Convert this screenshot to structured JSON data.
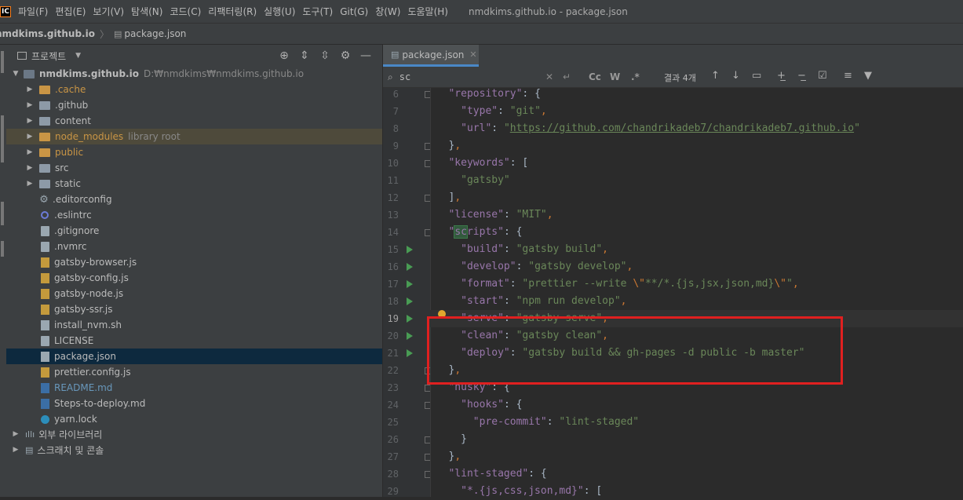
{
  "menu": {
    "logo": "IC",
    "items": [
      "파일(F)",
      "편집(E)",
      "보기(V)",
      "탐색(N)",
      "코드(C)",
      "리팩터링(R)",
      "실행(U)",
      "도구(T)",
      "Git(G)",
      "창(W)",
      "도움말(H)"
    ],
    "window_title": "nmdkims.github.io - package.json"
  },
  "breadcrumb": {
    "root": "nmdkims.github.io",
    "file": "package.json"
  },
  "project": {
    "title": "프로젝트",
    "root": {
      "name": "nmdkims.github.io",
      "path": "D:₩nmdkims₩nmdkims.github.io"
    },
    "items": [
      {
        "label": ".cache",
        "hint": ""
      },
      {
        "label": ".github",
        "hint": ""
      },
      {
        "label": "content",
        "hint": ""
      },
      {
        "label": "node_modules",
        "hint": "library root"
      },
      {
        "label": "public",
        "hint": ""
      },
      {
        "label": "src",
        "hint": ""
      },
      {
        "label": "static",
        "hint": ""
      },
      {
        "label": ".editorconfig",
        "hint": ""
      },
      {
        "label": ".eslintrc",
        "hint": ""
      },
      {
        "label": ".gitignore",
        "hint": ""
      },
      {
        "label": ".nvmrc",
        "hint": ""
      },
      {
        "label": "gatsby-browser.js",
        "hint": ""
      },
      {
        "label": "gatsby-config.js",
        "hint": ""
      },
      {
        "label": "gatsby-node.js",
        "hint": ""
      },
      {
        "label": "gatsby-ssr.js",
        "hint": ""
      },
      {
        "label": "install_nvm.sh",
        "hint": ""
      },
      {
        "label": "LICENSE",
        "hint": ""
      },
      {
        "label": "package.json",
        "hint": ""
      },
      {
        "label": "prettier.config.js",
        "hint": ""
      },
      {
        "label": "README.md",
        "hint": ""
      },
      {
        "label": "Steps-to-deploy.md",
        "hint": ""
      },
      {
        "label": "yarn.lock",
        "hint": ""
      }
    ],
    "external_libraries": "외부 라이브러리",
    "scratches": "스크래치 및 콘솔"
  },
  "editor": {
    "tab_label": "package.json",
    "search": {
      "query": "sc",
      "results": "결과 4개",
      "opt_case": "Cc",
      "opt_word": "W",
      "opt_regex": ".*"
    },
    "current_line": 19,
    "lines": [
      {
        "n": 6,
        "text": "  \"repository\": {"
      },
      {
        "n": 7,
        "text": "    \"type\": \"git\","
      },
      {
        "n": 8,
        "text": "    \"url\": \"https://github.com/chandrikadeb7/chandrikadeb7.github.io\""
      },
      {
        "n": 9,
        "text": "  },"
      },
      {
        "n": 10,
        "text": "  \"keywords\": ["
      },
      {
        "n": 11,
        "text": "    \"gatsby\""
      },
      {
        "n": 12,
        "text": "  ],"
      },
      {
        "n": 13,
        "text": "  \"license\": \"MIT\","
      },
      {
        "n": 14,
        "text": "  \"scripts\": {"
      },
      {
        "n": 15,
        "text": "    \"build\": \"gatsby build\","
      },
      {
        "n": 16,
        "text": "    \"develop\": \"gatsby develop\","
      },
      {
        "n": 17,
        "text": "    \"format\": \"prettier --write \\\"**/*.{js,jsx,json,md}\\\"\","
      },
      {
        "n": 18,
        "text": "    \"start\": \"npm run develop\","
      },
      {
        "n": 19,
        "text": "    \"serve\": \"gatsby serve\","
      },
      {
        "n": 20,
        "text": "    \"clean\": \"gatsby clean\","
      },
      {
        "n": 21,
        "text": "    \"deploy\": \"gatsby build && gh-pages -d public -b master\""
      },
      {
        "n": 22,
        "text": "  },"
      },
      {
        "n": 23,
        "text": "  \"husky\": {"
      },
      {
        "n": 24,
        "text": "    \"hooks\": {"
      },
      {
        "n": 25,
        "text": "      \"pre-commit\": \"lint-staged\""
      },
      {
        "n": 26,
        "text": "    }"
      },
      {
        "n": 27,
        "text": "  },"
      },
      {
        "n": 28,
        "text": "  \"lint-staged\": {"
      },
      {
        "n": 29,
        "text": "    \"*.{js,css,json,md}\": ["
      }
    ],
    "run_lines": [
      15,
      16,
      17,
      18,
      19,
      20,
      21
    ],
    "fold_lines": [
      6,
      9,
      10,
      12,
      14,
      22,
      23,
      24,
      26,
      27,
      28
    ],
    "annotation_color": "#e02020"
  }
}
